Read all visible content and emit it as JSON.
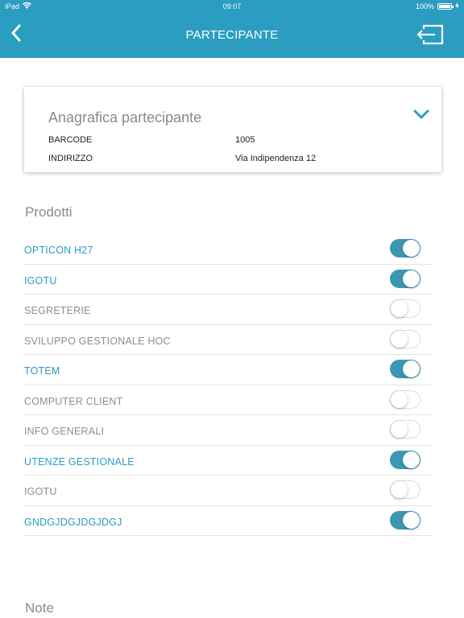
{
  "statusbar": {
    "device": "iPad",
    "time": "09:07",
    "battery": "100%",
    "battery_level": 1.0
  },
  "header": {
    "title": "PARTECIPANTE",
    "back_icon": "chevron-left-icon",
    "action_icon": "logout-icon",
    "background_color": "#2a9dc0"
  },
  "card": {
    "title": "Anagrafica partecipante",
    "toggle_icon": "chevron-down-icon",
    "fields": [
      {
        "label": "BARCODE",
        "value": "1005"
      },
      {
        "label": "INDIRIZZO",
        "value": "Via Indipendenza 12"
      }
    ]
  },
  "prodotti": {
    "title": "Prodotti",
    "items": [
      {
        "label": "OPTICON H27",
        "enabled": true
      },
      {
        "label": "IGOTU",
        "enabled": true
      },
      {
        "label": "SEGRETERIE",
        "enabled": false
      },
      {
        "label": "SVILUPPO GESTIONALE HOC",
        "enabled": false
      },
      {
        "label": "TOTEM",
        "enabled": true
      },
      {
        "label": "COMPUTER CLIENT",
        "enabled": false
      },
      {
        "label": "INFO GENERALI",
        "enabled": false
      },
      {
        "label": "UTENZE GESTIONALE",
        "enabled": true
      },
      {
        "label": "IGOTU",
        "enabled": false
      },
      {
        "label": "GNDGJDGJDGJDGJ",
        "enabled": true
      }
    ]
  },
  "note": {
    "title": "Note"
  },
  "colors": {
    "accent": "#2a9dc0",
    "switch_on": "#3a98b2",
    "muted_text": "#8e8e8e"
  }
}
